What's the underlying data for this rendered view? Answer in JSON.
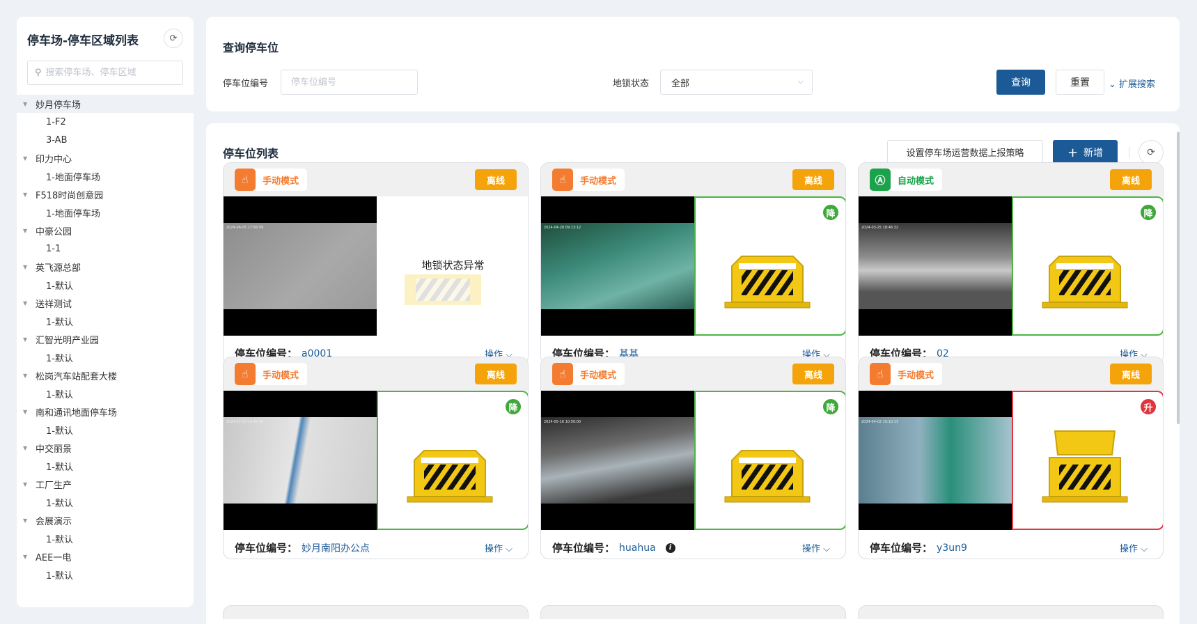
{
  "sidebar": {
    "title": "停车场-停车区域列表",
    "search_placeholder": "搜索停车场、停车区域",
    "tree": [
      {
        "label": "妙月停车场",
        "children": [
          "1-F2",
          "3-AB"
        ]
      },
      {
        "label": "印力中心",
        "children": [
          "1-地面停车场"
        ]
      },
      {
        "label": "F518时尚创意园",
        "children": [
          "1-地面停车场"
        ]
      },
      {
        "label": "中豪公园",
        "children": [
          "1-1"
        ]
      },
      {
        "label": "英飞源总部",
        "children": [
          "1-默认"
        ]
      },
      {
        "label": "送祥测试",
        "children": [
          "1-默认"
        ]
      },
      {
        "label": "汇智光明产业园",
        "children": [
          "1-默认"
        ]
      },
      {
        "label": "松岗汽车站配套大楼",
        "children": [
          "1-默认"
        ]
      },
      {
        "label": "南和通讯地面停车场",
        "children": [
          "1-默认"
        ]
      },
      {
        "label": "中交丽景",
        "children": [
          "1-默认"
        ]
      },
      {
        "label": "工厂生产",
        "children": [
          "1-默认"
        ]
      },
      {
        "label": "会展演示",
        "children": [
          "1-默认"
        ]
      },
      {
        "label": "AEE一电",
        "children": [
          "1-默认"
        ]
      }
    ]
  },
  "query": {
    "title": "查询停车位",
    "space_no_label": "停车位编号",
    "space_no_placeholder": "停车位编号",
    "lock_status_label": "地锁状态",
    "lock_status_value": "全部",
    "search_button": "查询",
    "reset_button": "重置",
    "expand_label": "扩展搜索"
  },
  "list": {
    "title": "停车位列表",
    "policy_button": "设置停车场运营数据上报策略",
    "add_button": "新增",
    "space_no_label": "停车位编号：",
    "op_label": "操作",
    "abnormal_text": "地锁状态异常",
    "cards": [
      {
        "mode": "手动模式",
        "mode_type": "manual",
        "status": "离线",
        "timestamp": "2024-06-05 17:56:59",
        "lock": "abnormal",
        "lock_badge": "",
        "space_no": "a0001",
        "info": false
      },
      {
        "mode": "手动模式",
        "mode_type": "manual",
        "status": "离线",
        "timestamp": "2024-04-28 09:13:12",
        "lock": "down",
        "lock_badge": "降",
        "space_no": "基基",
        "info": false
      },
      {
        "mode": "自动模式",
        "mode_type": "auto",
        "status": "离线",
        "timestamp": "2024-03-25 18:46:32",
        "lock": "down",
        "lock_badge": "降",
        "space_no": "02",
        "info": false
      },
      {
        "mode": "手动模式",
        "mode_type": "manual",
        "status": "离线",
        "timestamp": "2024-05-23 10:48:48",
        "lock": "down",
        "lock_badge": "降",
        "space_no": "妙月南阳办公点",
        "info": false
      },
      {
        "mode": "手动模式",
        "mode_type": "manual",
        "status": "离线",
        "timestamp": "2024-05-16 10:50:00",
        "lock": "down",
        "lock_badge": "降",
        "space_no": "huahua",
        "info": true
      },
      {
        "mode": "手动模式",
        "mode_type": "manual",
        "status": "离线",
        "timestamp": "2024-04-02 10:10:13",
        "lock": "up",
        "lock_badge": "升",
        "space_no": "y3un9",
        "info": false
      }
    ]
  },
  "colors": {
    "primary": "#1b5a96",
    "manual_mode": "#f47c30",
    "auto_mode": "#1aa34a",
    "offline": "#f5a30b",
    "lock_down": "#3ea83a",
    "lock_up": "#e0353d"
  },
  "icons": {
    "refresh": "refresh-icon",
    "search": "search-icon",
    "hand": "hand-icon",
    "auto": "auto-a-icon",
    "plus": "plus-icon",
    "chevron": "chevron-down-icon",
    "info": "info-icon"
  }
}
